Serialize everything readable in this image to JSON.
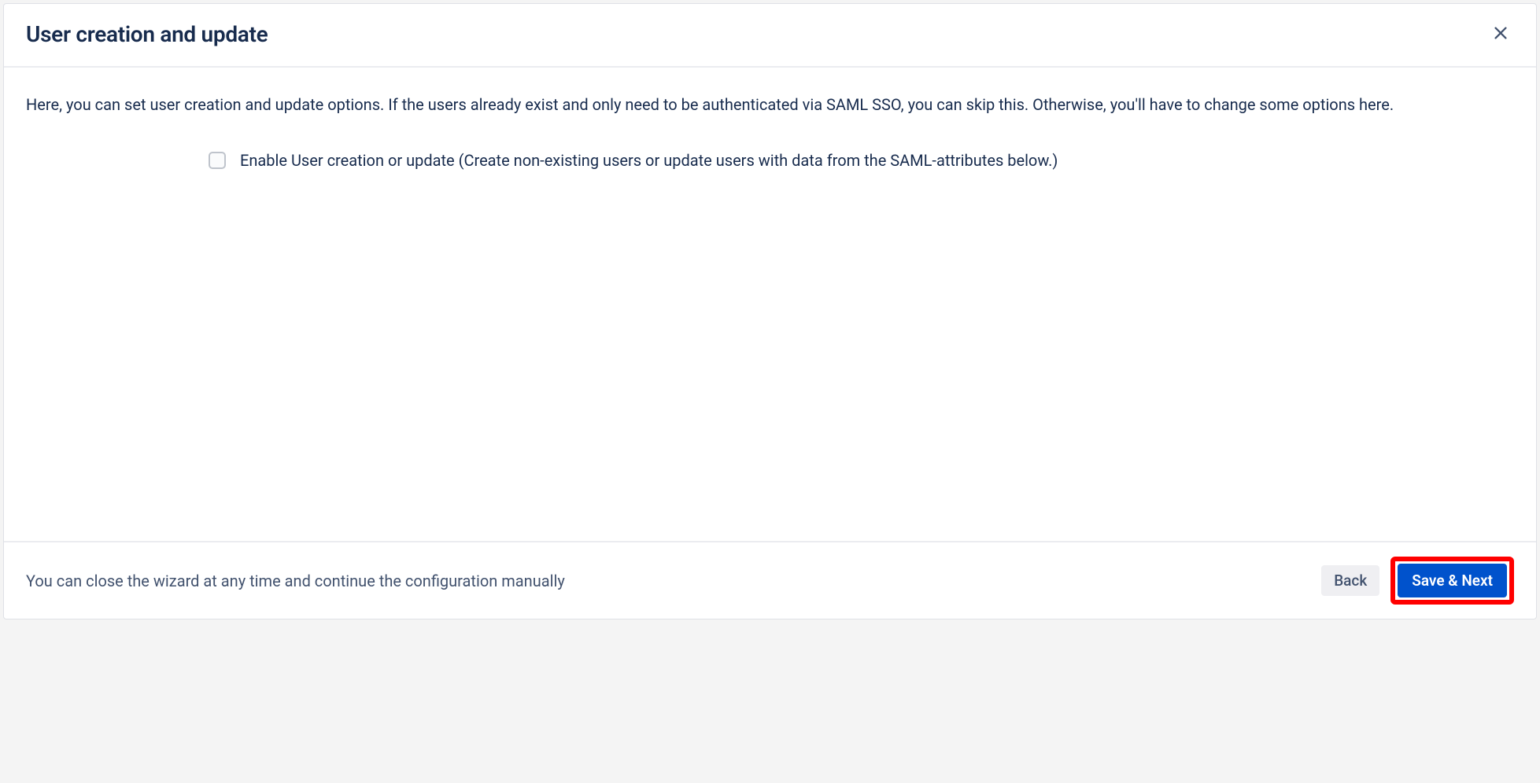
{
  "header": {
    "title": "User creation and update"
  },
  "body": {
    "description": "Here, you can set user creation and update options. If the users already exist and only need to be authenticated via SAML SSO, you can skip this. Otherwise, you'll have to change some options here.",
    "checkbox_label": "Enable User creation or update (Create non-existing users or update users with data from the SAML-attributes below.)"
  },
  "footer": {
    "hint_text": "You can close the wizard at any time and continue the configuration manually",
    "back_label": "Back",
    "next_label": "Save & Next"
  }
}
